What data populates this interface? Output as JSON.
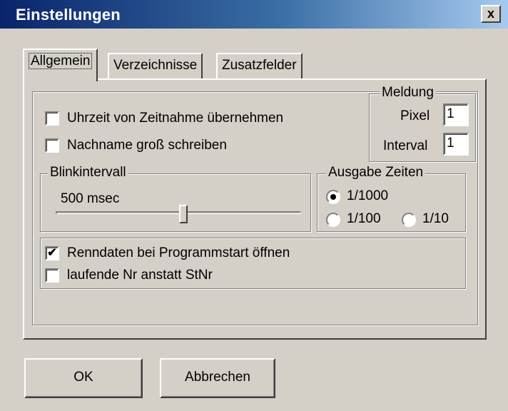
{
  "window": {
    "title": "Einstellungen",
    "close_label": "x"
  },
  "tabs": [
    {
      "label": "Allgemein",
      "active": true
    },
    {
      "label": "Verzeichnisse",
      "active": false
    },
    {
      "label": "Zusatzfelder",
      "active": false
    }
  ],
  "options": {
    "uhrzeit": {
      "label": "Uhrzeit von Zeitnahme übernehmen",
      "checked": false
    },
    "nachname": {
      "label": "Nachname groß schreiben",
      "checked": false
    }
  },
  "meldung": {
    "legend": "Meldung",
    "pixel_label": "Pixel",
    "pixel_value": "1",
    "interval_label": "Interval",
    "interval_value": "1"
  },
  "blinkintervall": {
    "legend": "Blinkintervall",
    "value_text": "500 msec",
    "slider_fraction": 0.52
  },
  "ausgabe_zeiten": {
    "legend": "Ausgabe Zeiten",
    "options": [
      {
        "label": "1/1000",
        "selected": true
      },
      {
        "label": "1/100",
        "selected": false
      },
      {
        "label": "1/10",
        "selected": false
      }
    ]
  },
  "bottom_options": {
    "renndaten": {
      "label": "Renndaten bei Programmstart öffnen",
      "checked": true
    },
    "laufende": {
      "label": "laufende Nr anstatt StNr",
      "checked": false
    }
  },
  "buttons": {
    "ok": "OK",
    "cancel": "Abbrechen"
  },
  "check_glyph": "✔"
}
